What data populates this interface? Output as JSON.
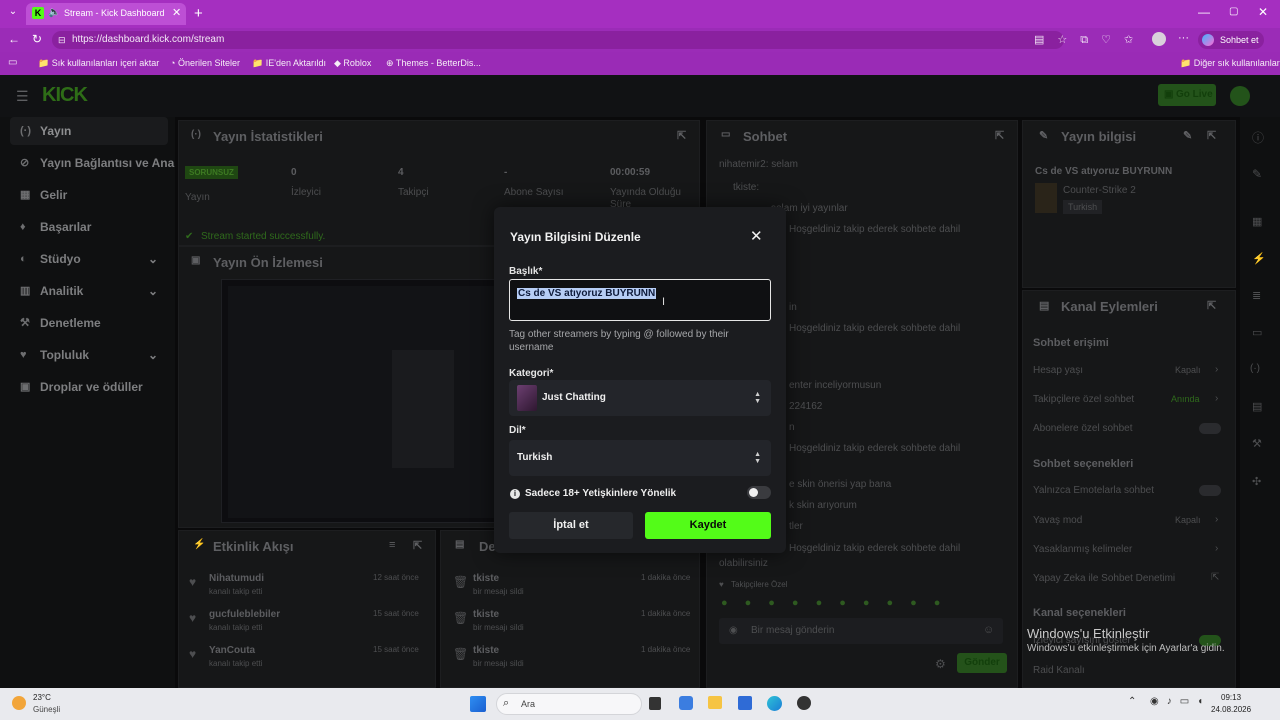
{
  "browser": {
    "tab_title": "Stream - Kick Dashboard",
    "url": "https://dashboard.kick.com/stream",
    "profile_button": "Sohbet et",
    "bookmarks": [
      "Sık kullanılanları içeri aktar",
      "Önerilen Siteler",
      "IE'den Aktarıldı",
      "Roblox",
      "Themes - BetterDis..."
    ],
    "other_bookmarks": "Diğer sık kullanılanlar"
  },
  "app": {
    "logo": "KICK",
    "go_live": "Go Live"
  },
  "sidebar": {
    "items": [
      {
        "label": "Yayın",
        "icon": "broadcast-icon"
      },
      {
        "label": "Yayın Bağlantısı ve Anahtar",
        "icon": "link-icon"
      },
      {
        "label": "Gelir",
        "icon": "revenue-icon"
      },
      {
        "label": "Başarılar",
        "icon": "trophy-icon"
      },
      {
        "label": "Stüdyo",
        "icon": "studio-icon"
      },
      {
        "label": "Analitik",
        "icon": "analytics-icon"
      },
      {
        "label": "Denetleme",
        "icon": "moderation-icon"
      },
      {
        "label": "Topluluk",
        "icon": "community-icon"
      },
      {
        "label": "Droplar ve ödüller",
        "icon": "gift-icon"
      }
    ]
  },
  "stats": {
    "title": "Yayın İstatistikleri",
    "status_badge": "SORUNSUZ",
    "status_label": "Yayın",
    "viewers_value": "0",
    "viewers_label": "İzleyici",
    "followers_value": "4",
    "followers_label": "Takipçi",
    "subs_value": "-",
    "subs_label": "Abone Sayısı",
    "time_value": "00:00:59",
    "time_label": "Yayında Olduğu Süre",
    "success_msg": "Stream started successfully."
  },
  "preview": {
    "title": "Yayın Ön İzlemesi"
  },
  "activity": {
    "title": "Etkinlik Akışı",
    "items": [
      {
        "name": "Nihatumudi",
        "action": "kanalı takip etti",
        "time": "12 saat önce"
      },
      {
        "name": "gucfuleblebiler",
        "action": "kanalı takip etti",
        "time": "15 saat önce"
      },
      {
        "name": "YanCouta",
        "action": "kanalı takip etti",
        "time": "15 saat önce"
      }
    ]
  },
  "mod_log": {
    "title": "De",
    "items": [
      {
        "name": "tkiste",
        "action": "bir mesajı sildi",
        "time": "1 dakika önce"
      },
      {
        "name": "tkiste",
        "action": "bir mesajı sildi",
        "time": "1 dakika önce"
      },
      {
        "name": "tkiste",
        "action": "bir mesajı sildi",
        "time": "1 dakika önce"
      }
    ]
  },
  "chat": {
    "title": "Sohbet",
    "messages": [
      "nihatemir2: selam",
      "tkiste:",
      "selam iyi yayınlar",
      "Hoşgeldiniz takip ederek sohbete dahil",
      "in",
      "Hoşgeldiniz takip ederek sohbete dahil",
      "enter inceliyormusun",
      "224162",
      "n",
      "Hoşgeldiniz takip ederek sohbete dahil",
      "e skin önerisi yap bana",
      "k skin arıyorum",
      "tler",
      "Hoşgeldiniz takip ederek sohbete dahil",
      "olabilirsiniz"
    ],
    "followers_only": "Takipçilere Özel",
    "input_placeholder": "Bir mesaj gönderin",
    "send": "Gönder"
  },
  "stream_info": {
    "title": "Yayın bilgisi",
    "stream_title": "Cs de VS atıyoruz BUYRUNN",
    "category": "Counter-Strike 2",
    "language_tag": "Turkish"
  },
  "channel_actions": {
    "title": "Kanal Eylemleri",
    "section1": "Sohbet erişimi",
    "account_age": "Hesap yaşı",
    "account_age_value": "Kapalı",
    "followers_chat": "Takipçilere özel sohbet",
    "followers_chat_value": "Anında",
    "subs_chat": "Abonelere özel sohbet",
    "section2": "Sohbet seçenekleri",
    "emote_only": "Yalnızca Emotelarla sohbet",
    "slow_mode": "Yavaş mod",
    "slow_mode_value": "Kapalı",
    "banned_words": "Yasaklanmış kelimeler",
    "ai_moderation": "Yapay Zeka ile Sohbet Denetimi",
    "section3": "Kanal seçenekleri",
    "viewer_count": "İzleyici sayısını göster",
    "raid": "Raid Kanalı"
  },
  "windows": {
    "activate_title": "Windows'u Etkinleştir",
    "activate_sub": "Windows'u etkinleştirmek için Ayarlar'a gidin."
  },
  "taskbar": {
    "temp": "23°C",
    "weather": "Güneşli",
    "search": "Ara",
    "time": "09:13",
    "date": "24.08.2026"
  },
  "modal": {
    "title": "Yayın Bilgisini Düzenle",
    "title_label": "Başlık*",
    "title_value": "Cs de VS atıyoruz BUYRUNN",
    "hint": "Tag other streamers by typing @ followed by their username",
    "category_label": "Kategori*",
    "category_value": "Just Chatting",
    "language_label": "Dil*",
    "language_value": "Turkish",
    "adult_label": "Sadece 18+ Yetişkinlere Yönelik",
    "cancel": "İptal et",
    "save": "Kaydet"
  },
  "colors": {
    "accent": "#53fc18",
    "browser": "#a52fc0",
    "modal_bg": "#1b1c1f"
  }
}
